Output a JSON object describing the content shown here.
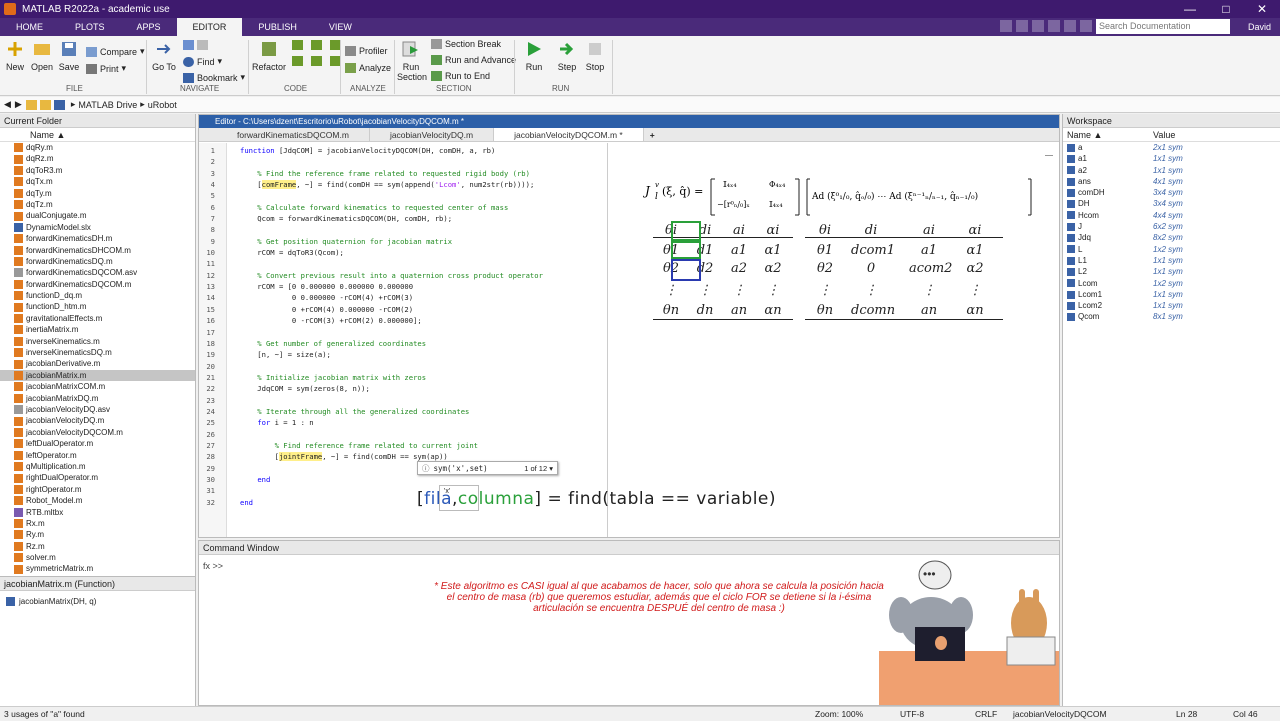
{
  "titlebar": {
    "title": "MATLAB R2022a - academic use",
    "min": "—",
    "max": "□",
    "close": "✕"
  },
  "tabs": [
    "HOME",
    "PLOTS",
    "APPS",
    "EDITOR",
    "PUBLISH",
    "VIEW"
  ],
  "search": {
    "placeholder": "Search Documentation"
  },
  "user": "David",
  "ribbon": {
    "file": {
      "new": "New",
      "open": "Open",
      "save": "Save",
      "compare": "Compare",
      "print": "Print",
      "group": "FILE"
    },
    "navigate": {
      "goto": "Go To",
      "find": "Find",
      "bookmark": "Bookmark",
      "group": "NAVIGATE"
    },
    "code": {
      "refactor": "Refactor",
      "group": "CODE"
    },
    "analyze": {
      "profiler": "Profiler",
      "analyze": "Analyze",
      "group": "ANALYZE"
    },
    "section": {
      "run_section": "Run\nSection",
      "section_break": "Section Break",
      "run_advance": "Run and Advance",
      "run_to_end": "Run to End",
      "group": "SECTION"
    },
    "run": {
      "run": "Run",
      "step": "Step",
      "stop": "Stop",
      "group": "RUN"
    }
  },
  "path": {
    "parts": [
      "MATLAB Drive",
      "uRobot"
    ],
    "sep": "▸"
  },
  "current_folder": {
    "title": "Current Folder",
    "col": "Name ▲",
    "files": [
      "dqRy.m",
      "dqRz.m",
      "dqToR3.m",
      "dqTx.m",
      "dqTy.m",
      "dqTz.m",
      "dualConjugate.m",
      "DynamicModel.slx",
      "forwardKinematicsDH.m",
      "forwardKinematicsDHCOM.m",
      "forwardKinematicsDQ.m",
      "forwardKinematicsDQCOM.asv",
      "forwardKinematicsDQCOM.m",
      "functionD_dq.m",
      "functionD_htm.m",
      "gravitationalEffects.m",
      "inertiaMatrix.m",
      "inverseKinematics.m",
      "inverseKinematicsDQ.m",
      "jacobianDerivative.m",
      "jacobianMatrix.m",
      "jacobianMatrixCOM.m",
      "jacobianMatrixDQ.m",
      "jacobianVelocityDQ.asv",
      "jacobianVelocityDQ.m",
      "jacobianVelocityDQCOM.m",
      "leftDualOperator.m",
      "leftOperator.m",
      "qMultiplication.m",
      "rightDualOperator.m",
      "rightOperator.m",
      "Robot_Model.m",
      "RTB.mltbx",
      "Rx.m",
      "Ry.m",
      "Rz.m",
      "solver.m",
      "symmetricMatrix.m"
    ],
    "selected": "jacobianMatrix.m"
  },
  "function_details": {
    "title": "jacobianMatrix.m  (Function)",
    "signature": "jacobianMatrix(DH, q)"
  },
  "editor": {
    "title": "Editor - C:\\Users\\dzent\\Escritorio\\uRobot\\jacobianVelocityDQCOM.m *",
    "tabs": [
      "forwardKinematicsDQCOM.m",
      "jacobianVelocityDQ.m",
      "jacobianVelocityDQCOM.m *"
    ],
    "plus": "+",
    "lines": [
      {
        "n": "1",
        "t": "function [JdqCOM] = jacobianVelocityDQCOM(DH, comDH, a, rb)",
        "k": "fn"
      },
      {
        "n": "2",
        "t": "",
        "k": ""
      },
      {
        "n": "3",
        "t": "    % Find the reference frame related to requested rigid body (rb)",
        "k": "cm"
      },
      {
        "n": "4",
        "t": "    [comFrame, ~] = find(comDH == sym(append('Lcom', num2str(rb))));",
        "k": "hl1"
      },
      {
        "n": "5",
        "t": "",
        "k": ""
      },
      {
        "n": "6",
        "t": "    % Calculate forward kinematics to requested center of mass",
        "k": "cm"
      },
      {
        "n": "7",
        "t": "    Qcom = forwardKinematicsDQCOM(DH, comDH, rb);",
        "k": ""
      },
      {
        "n": "8",
        "t": "",
        "k": ""
      },
      {
        "n": "9",
        "t": "    % Get position quaternion for jacobian matrix",
        "k": "cm"
      },
      {
        "n": "10",
        "t": "    rCOM = dqToR3(Qcom);",
        "k": ""
      },
      {
        "n": "11",
        "t": "",
        "k": ""
      },
      {
        "n": "12",
        "t": "    % Convert previous result into a quaternion cross product operator",
        "k": "cm"
      },
      {
        "n": "13",
        "t": "    rCOM = [0 0.000000 0.000000 0.000000",
        "k": ""
      },
      {
        "n": "14",
        "t": "            0 0.000000 -rCOM(4) +rCOM(3)",
        "k": ""
      },
      {
        "n": "15",
        "t": "            0 +rCOM(4) 0.000000 -rCOM(2)",
        "k": ""
      },
      {
        "n": "16",
        "t": "            0 -rCOM(3) +rCOM(2) 0.000000];",
        "k": ""
      },
      {
        "n": "17",
        "t": "",
        "k": ""
      },
      {
        "n": "18",
        "t": "    % Get number of generalized coordinates",
        "k": "cm"
      },
      {
        "n": "19",
        "t": "    [n, ~] = size(a);",
        "k": ""
      },
      {
        "n": "20",
        "t": "",
        "k": ""
      },
      {
        "n": "21",
        "t": "    % Initialize jacobian matrix with zeros",
        "k": "cm"
      },
      {
        "n": "22",
        "t": "    JdqCOM = sym(zeros(8, n));",
        "k": ""
      },
      {
        "n": "23",
        "t": "",
        "k": ""
      },
      {
        "n": "24",
        "t": "    % Iterate through all the generalized coordinates",
        "k": "cm"
      },
      {
        "n": "25",
        "t": "    for i = 1 : n",
        "k": "for"
      },
      {
        "n": "26",
        "t": "",
        "k": ""
      },
      {
        "n": "27",
        "t": "        % Find reference frame related to current joint",
        "k": "cm"
      },
      {
        "n": "28",
        "t": "        [jointFrame, ~] = find(comDH == sym(ap))",
        "k": "hl2"
      },
      {
        "n": "29",
        "t": "",
        "k": ""
      },
      {
        "n": "30",
        "t": "    end",
        "k": "end"
      },
      {
        "n": "31",
        "t": "",
        "k": ""
      },
      {
        "n": "32",
        "t": "end",
        "k": "end"
      }
    ],
    "suggestion": {
      "sig": "sym('x',set)",
      "count": "1 of 12 ▾",
      "item": "'x'"
    },
    "overlay": {
      "open": "[",
      "a": "fila",
      "comma": ",",
      "b": "columna",
      "rest": "] = find(tabla == variable)"
    },
    "math": {
      "lhs": "J",
      "header": [
        "θi",
        "di",
        "ai",
        "αi",
        "θi",
        "di",
        "ai",
        "αi"
      ],
      "left_rows": [
        [
          "θ1",
          "d1",
          "a1",
          "α1"
        ],
        [
          "θ2",
          "d2",
          "a2",
          "α2"
        ],
        [
          "⋮",
          "⋮",
          "⋮",
          "⋮"
        ],
        [
          "θn",
          "dn",
          "an",
          "αn"
        ]
      ],
      "right_rows": [
        [
          "θ1",
          "dcom1",
          "a1",
          "α1"
        ],
        [
          "θ2",
          "0",
          "acom2",
          "α2"
        ],
        [
          "⋮",
          "⋮",
          "⋮",
          "⋮"
        ],
        [
          "θn",
          "dcomn",
          "an",
          "αn"
        ]
      ]
    }
  },
  "command_window": {
    "title": "Command Window",
    "prompt": "fx >>",
    "note": "* Este algoritmo es CASI igual al que acabamos de hacer, solo que ahora se calcula la posición hacia el centro de masa (rb) que queremos estudiar, además que el ciclo FOR se detiene si la i-ésima articulación se encuentra DESPUÉ del centro de masa :)"
  },
  "workspace": {
    "title": "Workspace",
    "cols": [
      "Name ▲",
      "Value"
    ],
    "rows": [
      [
        "a",
        "2x1 sym"
      ],
      [
        "a1",
        "1x1 sym"
      ],
      [
        "a2",
        "1x1 sym"
      ],
      [
        "ans",
        "4x1 sym"
      ],
      [
        "comDH",
        "3x4 sym"
      ],
      [
        "DH",
        "3x4 sym"
      ],
      [
        "Hcom",
        "4x4 sym"
      ],
      [
        "J",
        "6x2 sym"
      ],
      [
        "Jdq",
        "8x2 sym"
      ],
      [
        "L",
        "1x2 sym"
      ],
      [
        "L1",
        "1x1 sym"
      ],
      [
        "L2",
        "1x1 sym"
      ],
      [
        "Lcom",
        "1x2 sym"
      ],
      [
        "Lcom1",
        "1x1 sym"
      ],
      [
        "Lcom2",
        "1x1 sym"
      ],
      [
        "Qcom",
        "8x1 sym"
      ]
    ]
  },
  "status": {
    "left": "3 usages of \"a\" found",
    "zoom": "Zoom: 100%",
    "enc": "UTF-8",
    "eol": "CRLF",
    "file": "jacobianVelocityDQCOM",
    "ln": "Ln  28",
    "col": "Col  46"
  }
}
